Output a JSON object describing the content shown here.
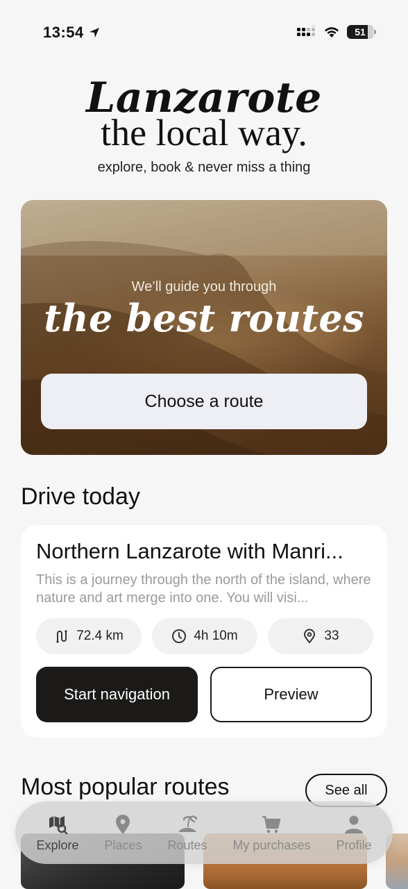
{
  "status_bar": {
    "time": "13:54",
    "battery": "51"
  },
  "header": {
    "brand_line1": "Lanzarote",
    "brand_line2": "the local way.",
    "tagline": "explore, book & never miss a thing"
  },
  "hero": {
    "subtitle": "We’ll guide you through",
    "title": "the best routes",
    "button_label": "Choose a route"
  },
  "drive_today": {
    "section_title": "Drive today",
    "card": {
      "title": "Northern Lanzarote with Manri...",
      "description": "This is a journey through the north of the island, where nature and art merge into one. You will visi...",
      "distance": "72.4 km",
      "duration": "4h 10m",
      "stops": "33",
      "start_label": "Start navigation",
      "preview_label": "Preview"
    }
  },
  "popular": {
    "section_title": "Most popular routes",
    "see_all_label": "See all"
  },
  "bottom_nav": {
    "items": [
      {
        "label": "Explore",
        "icon": "map-search-icon",
        "active": true
      },
      {
        "label": "Places",
        "icon": "location-pin-icon"
      },
      {
        "label": "Routes",
        "icon": "island-icon"
      },
      {
        "label": "My purchases",
        "icon": "cart-icon"
      },
      {
        "label": "Profile",
        "icon": "person-icon"
      }
    ]
  }
}
